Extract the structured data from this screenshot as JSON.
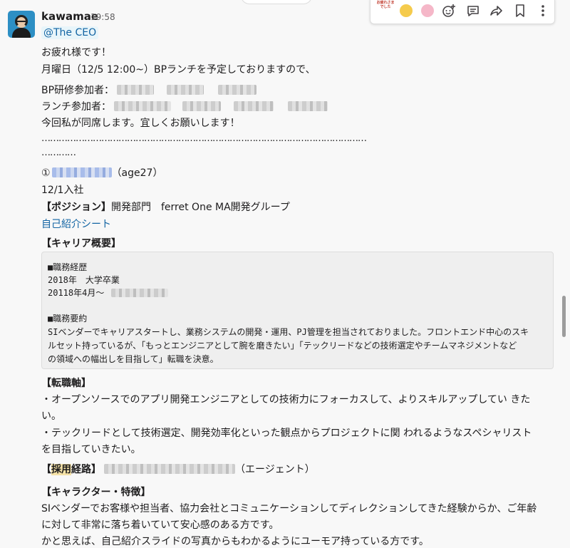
{
  "message": {
    "sender": "kawamae",
    "time": "19:58",
    "mention": "@The CEO",
    "line_greeting": "お疲れ様です！",
    "line_schedule": "月曜日（12/5 12:00~）BPランチを予定しておりますので、",
    "label_bp_training": "BP研修参加者：",
    "label_lunch": "ランチ参加者：",
    "line_attend": "今回私が同席します。宜しくお願いします！",
    "dots_line1": "……………………………………………………………………………………………………",
    "dots_line2": "…………",
    "person_index": "①",
    "person_age": "（age27）",
    "join_date": "12/1入社",
    "position_label": "【ポジション】",
    "position_value": "開発部門　ferret One MA開発グループ",
    "intro_link": "自己紹介シート",
    "career_header": "【キャリア概要】",
    "code_lines": {
      "history_title": "■職務経歴",
      "history_1": "2018年　大学卒業",
      "history_2": "20118年4月〜",
      "summary_title": "■職務要約",
      "summary_1": "SIベンダーでキャリアスタートし、業務システムの開発・運用、PJ管理を担当されておりました。フロントエンド中心のスキ",
      "summary_2": "ルセット持っているが、「もっとエンジニアとして腕を磨きたい」「テックリードなどの技術選定やチームマネジメントなど",
      "summary_3": "の領域への幅出しを目指して」転職を決意。"
    },
    "axis_header": "【転職軸】",
    "axis_1a": "・オープンソースでのアプリ開発エンジニアとしての技術力にフォーカスして、よりスキルアップしてい きた",
    "axis_1b": "い。",
    "axis_2a": "・テックリードとして技術選定、開発効率化といった観点からプロジェクトに関 われるようなスペシャリスト",
    "axis_2b": "を目指していきたい。",
    "route_open": "【",
    "route_hl": "採用",
    "route_close": "経路】",
    "route_suffix": "（エージェント）",
    "character_header": "【キャラクター・特徴】",
    "char_1": "SIベンダーでお客様や担当者、協力会社とコミュニケーションしてディレクションしてきた経験からか、ご年齢",
    "char_2": "に対して非常に落ち着いていて安心感のある方です。",
    "char_3": "かと思えば、自己紹介スライドの写真からもわかるようにユーモア持っている方です。"
  },
  "toolbar": {
    "emoji_text": "お疲れさまでした",
    "icons": [
      "custom-emoji-otsukare",
      "emoji-face",
      "emoji-face-pink",
      "add-reaction-icon",
      "thread-reply-icon",
      "share-icon",
      "bookmark-icon",
      "more-options-icon"
    ]
  },
  "colors": {
    "link": "#1264a3",
    "mention_bg": "#e8f5fa",
    "highlight": "#f2c744",
    "code_bg": "#efefef"
  }
}
